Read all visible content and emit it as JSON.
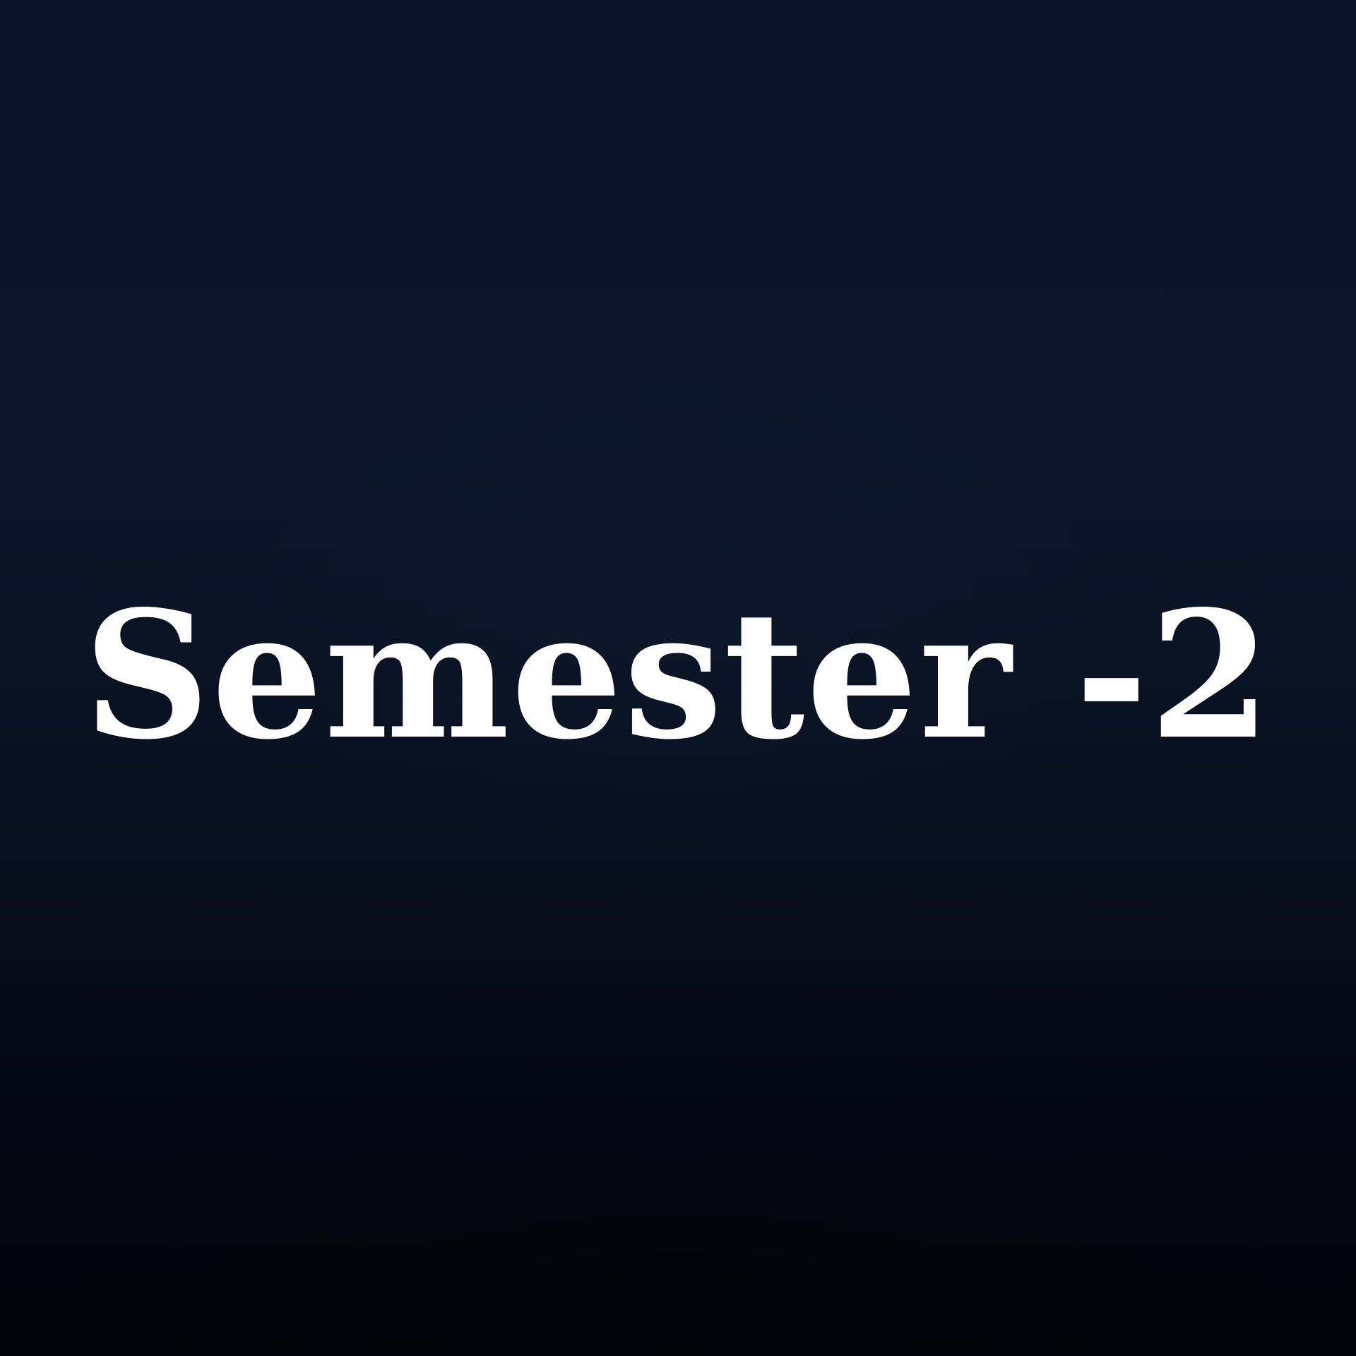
{
  "background_colors": {
    "top": "#0a1628",
    "bottom": "#02040b"
  },
  "title": {
    "text": "Semester -2",
    "color": "#ffffff"
  }
}
